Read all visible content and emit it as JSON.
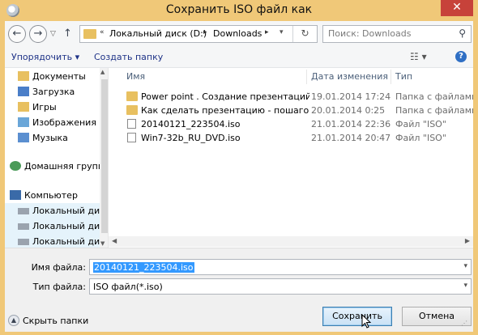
{
  "window": {
    "title": "Сохранить ISO файл как"
  },
  "navbar": {
    "address_parts": [
      "Локальный диск (D:)",
      "Downloads"
    ],
    "search_placeholder": "Поиск: Downloads"
  },
  "toolbar": {
    "organize": "Упорядочить ▾",
    "new_folder": "Создать папку"
  },
  "nav_items": [
    {
      "label": "Документы",
      "icon": "documents-icon"
    },
    {
      "label": "Загрузка",
      "icon": "downloads-icon"
    },
    {
      "label": "Игры",
      "icon": "games-icon"
    },
    {
      "label": "Изображения",
      "icon": "pictures-icon"
    },
    {
      "label": "Музыка",
      "icon": "music-icon"
    },
    {
      "label": "Домашняя группа",
      "icon": "homegroup-icon"
    },
    {
      "label": "Компьютер",
      "icon": "computer-icon"
    },
    {
      "label": "Локальный диск",
      "icon": "drive-icon"
    },
    {
      "label": "Локальный диск",
      "icon": "drive-icon"
    },
    {
      "label": "Локальный диск",
      "icon": "drive-icon"
    }
  ],
  "columns": {
    "name": "Имя",
    "date": "Дата изменения",
    "type": "Тип"
  },
  "files": [
    {
      "name": "Power point . Создание презентаций с н...",
      "date": "19.01.2014 17:24",
      "type": "Папка с файлами",
      "kind": "folder"
    },
    {
      "name": "Как сделать презентацию - пошаговое ...",
      "date": "20.01.2014 0:25",
      "type": "Папка с файлами",
      "kind": "folder"
    },
    {
      "name": "20140121_223504.iso",
      "date": "21.01.2014 22:36",
      "type": "Файл \"ISO\"",
      "kind": "file"
    },
    {
      "name": "Win7-32b_RU_DVD.iso",
      "date": "21.01.2014 20:47",
      "type": "Файл \"ISO\"",
      "kind": "file"
    }
  ],
  "form": {
    "filename_label": "Имя файла:",
    "filename_value": "20140121_223504.iso",
    "filetype_label": "Тип файла:",
    "filetype_value": "ISO файл(*.iso)"
  },
  "buttons": {
    "hide_folders": "Скрыть папки",
    "save": "Сохранить",
    "cancel": "Отмена"
  },
  "colors": {
    "frame": "#f0c878",
    "close": "#c7423a",
    "selection": "#3399ff"
  }
}
